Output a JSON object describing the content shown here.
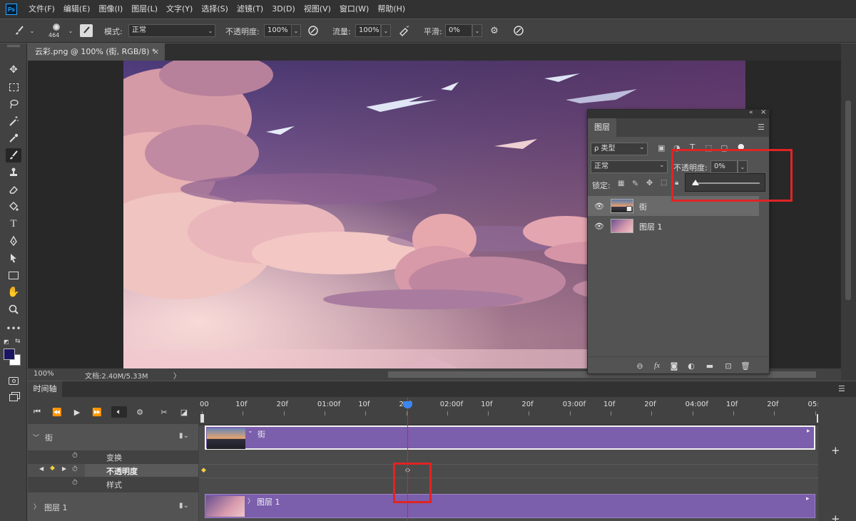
{
  "app": {
    "logo": "Ps"
  },
  "menu": [
    "文件(F)",
    "编辑(E)",
    "图像(I)",
    "图层(L)",
    "文字(Y)",
    "选择(S)",
    "滤镜(T)",
    "3D(D)",
    "视图(V)",
    "窗口(W)",
    "帮助(H)"
  ],
  "options": {
    "brush_size": "464",
    "mode_label": "模式:",
    "mode_value": "正常",
    "opacity_label": "不透明度:",
    "opacity_value": "100%",
    "flow_label": "流量:",
    "flow_value": "100%",
    "smooth_label": "平滑:",
    "smooth_value": "0%"
  },
  "document": {
    "tab_title": "云彩.png @ 100% (街, RGB/8) *",
    "close": "×"
  },
  "status": {
    "zoom": "100%",
    "doc_info": "文档:2.40M/5.33M",
    "arrow": "〉"
  },
  "layers_panel": {
    "tab": "图层",
    "filter_value": "ρ 类型",
    "blend_value": "正常",
    "opacity_label": "不透明度:",
    "opacity_value": "0%",
    "lock_label": "锁定:",
    "layers": [
      {
        "name": "街",
        "selected": true
      },
      {
        "name": "图层 1",
        "selected": false
      }
    ],
    "popup_value": 0
  },
  "timeline": {
    "tab": "时间轴",
    "ruler_labels": [
      "00",
      "10f",
      "20f",
      "01:00f",
      "10f",
      "20f",
      "02:00f",
      "10f",
      "20f",
      "03:00f",
      "10f",
      "20f",
      "04:00f",
      "10f",
      "20f",
      "05:0"
    ],
    "tracks": {
      "street": {
        "name": "街",
        "properties": [
          "变换",
          "不透明度",
          "样式"
        ]
      },
      "layer1": {
        "name": "图层 1"
      }
    },
    "clips": {
      "street": "街",
      "layer1": "图层 1"
    },
    "add": "+"
  },
  "colors": {
    "accent_red": "#e02424",
    "clip_purple": "#7b5eac",
    "playhead_blue": "#3b86f0",
    "keyframe_yellow": "#f0d040"
  }
}
